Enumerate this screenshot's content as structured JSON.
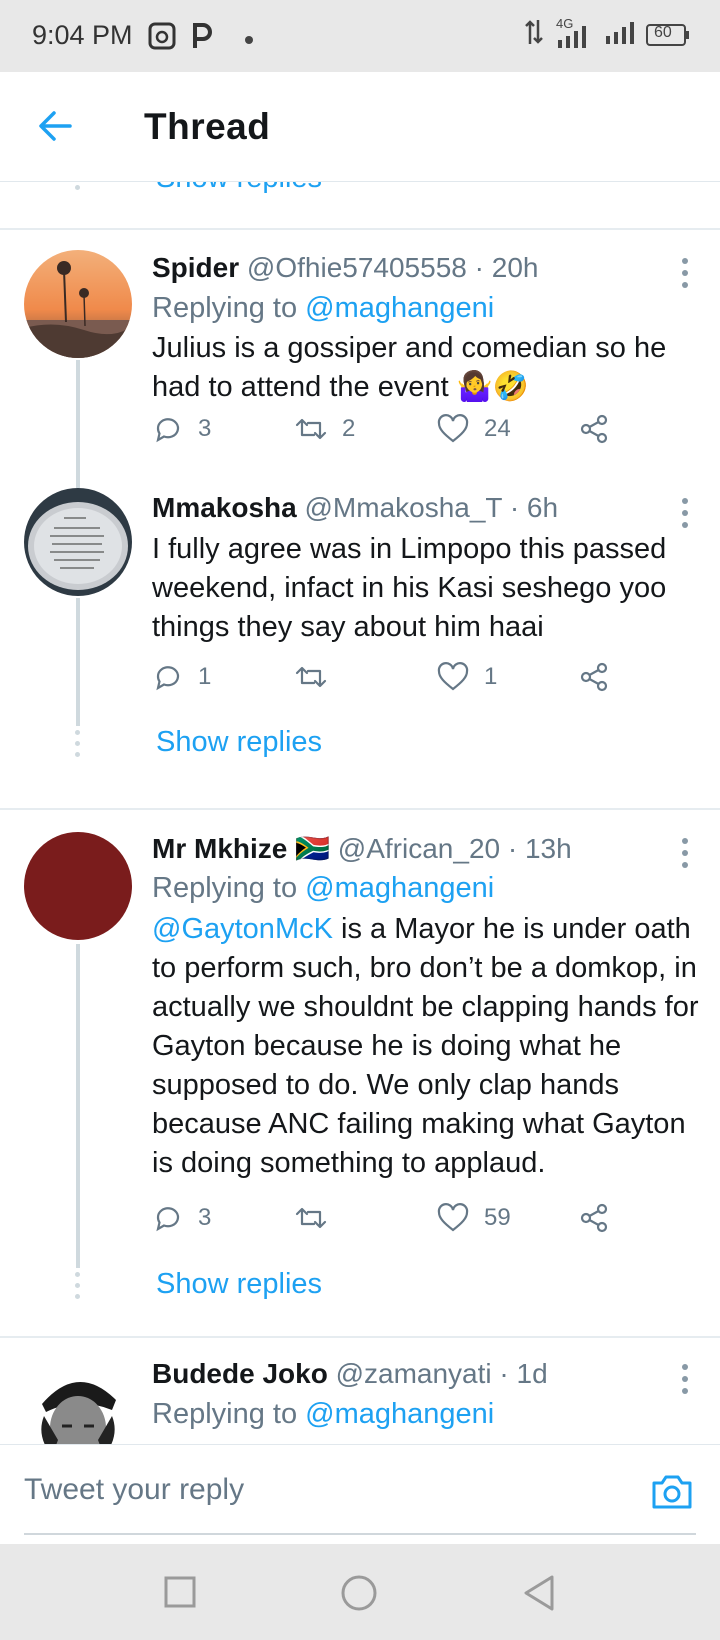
{
  "status_bar": {
    "time": "9:04 PM",
    "network": "4G",
    "battery": "60"
  },
  "header": {
    "title": "Thread"
  },
  "top_partial": {
    "show_replies": "Show replies"
  },
  "tweets": [
    {
      "name": "Spider",
      "handle": "@Ofhie57405558",
      "time": "· 20h",
      "replying_prefix": "Replying to",
      "replying_to": "@maghangeni",
      "text": "Julius is a gossiper and comedian so he had to attend the event 🤷‍♀️🤣",
      "replies": "3",
      "retweets": "2",
      "likes": "24"
    },
    {
      "name": "Mmakosha",
      "handle": "@Mmakosha_T",
      "time": "· 6h",
      "text": "I fully agree was in Limpopo this passed weekend, infact in his Kasi seshego yoo things they say about him haai",
      "replies": "1",
      "retweets": "",
      "likes": "1",
      "show_replies": "Show replies"
    },
    {
      "name": "Mr Mkhize",
      "flag": "🇿🇦",
      "handle": "@African_20",
      "time": "· 13h",
      "replying_prefix": "Replying to",
      "replying_to": "@maghangeni",
      "text_mention": "@GaytonMcK",
      "text": " is a Mayor he is under oath to perform such, bro don’t be a domkop, in actually we shouldnt be clapping hands for Gayton because he is doing what he supposed to do. We only clap hands because ANC failing making what Gayton is doing something to applaud.",
      "replies": "3",
      "retweets": "",
      "likes": "59",
      "show_replies": "Show replies"
    },
    {
      "name": "Budede Joko",
      "handle": "@zamanyati",
      "time": "· 1d",
      "replying_prefix": "Replying to",
      "replying_to": "@maghangeni"
    }
  ],
  "composer": {
    "placeholder": "Tweet your reply"
  },
  "colors": {
    "accent": "#1da1f2",
    "muted": "#657786",
    "text": "#14171a"
  }
}
